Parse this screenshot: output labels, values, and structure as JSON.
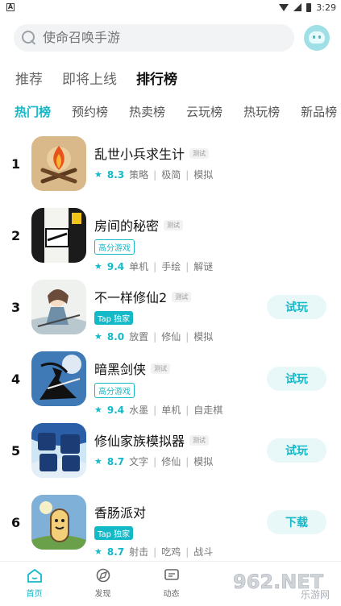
{
  "statusbar": {
    "notif": "A",
    "time": "3:29"
  },
  "search": {
    "placeholder": "使命召唤手游"
  },
  "main_tabs": [
    {
      "label": "推荐"
    },
    {
      "label": "即将上线"
    },
    {
      "label": "排行榜"
    }
  ],
  "sub_tabs": [
    {
      "label": "热门榜"
    },
    {
      "label": "预约榜"
    },
    {
      "label": "热卖榜"
    },
    {
      "label": "云玩榜"
    },
    {
      "label": "热玩榜"
    },
    {
      "label": "新品榜"
    }
  ],
  "apps": [
    {
      "rank": "1",
      "name": "乱世小兵求生计",
      "badge": "测试",
      "tag": "",
      "star": "★",
      "score": "8.3",
      "genres": [
        "策略",
        "极简",
        "模拟"
      ],
      "action": "",
      "icon": "campfire-icon"
    },
    {
      "rank": "2",
      "name": "房间的秘密",
      "badge": "测试",
      "tag": "高分游戏",
      "star": "★",
      "score": "9.4",
      "genres": [
        "单机",
        "手绘",
        "解谜"
      ],
      "action": "",
      "icon": "escape-door-icon"
    },
    {
      "rank": "3",
      "name": "不一样修仙2",
      "badge": "测试",
      "tag": "Tap 独家",
      "star": "★",
      "score": "8.0",
      "genres": [
        "放置",
        "修仙",
        "模拟"
      ],
      "action": "试玩",
      "icon": "cultivator-icon"
    },
    {
      "rank": "4",
      "name": "暗黑剑侠",
      "badge": "测试",
      "tag": "高分游戏",
      "star": "★",
      "score": "9.4",
      "genres": [
        "水墨",
        "单机",
        "自走棋"
      ],
      "action": "试玩",
      "icon": "swordsman-icon"
    },
    {
      "rank": "5",
      "name": "修仙家族模拟器",
      "badge": "测试",
      "tag": "",
      "star": "★",
      "score": "8.7",
      "genres": [
        "文字",
        "修仙",
        "模拟"
      ],
      "action": "试玩",
      "icon": "xiuxian-family-icon"
    },
    {
      "rank": "6",
      "name": "香肠派对",
      "badge": "",
      "tag": "Tap 独家",
      "star": "★",
      "score": "8.7",
      "genres": [
        "射击",
        "吃鸡",
        "战斗"
      ],
      "action": "下载",
      "icon": "sausage-icon"
    }
  ],
  "sep": "|",
  "bottom_nav": [
    {
      "label": "首页",
      "icon": "home-icon"
    },
    {
      "label": "发现",
      "icon": "discover-icon"
    },
    {
      "label": "动态",
      "icon": "chat-icon"
    }
  ],
  "watermark": {
    "text": "962.NET",
    "sub": "乐游网"
  },
  "colors": {
    "accent": "#14b9c8"
  }
}
